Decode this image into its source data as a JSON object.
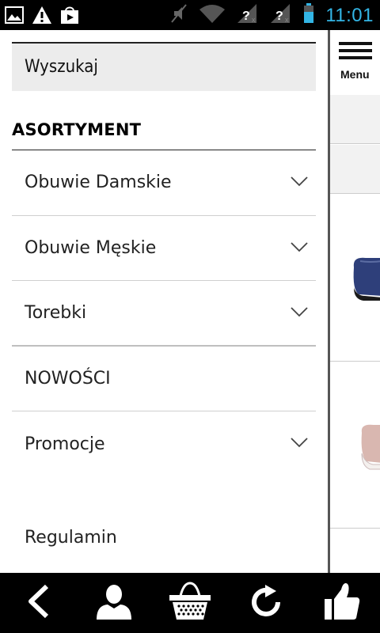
{
  "status_bar": {
    "time": "11:01",
    "icons": [
      "image-icon",
      "warning-icon",
      "store-icon",
      "mute-icon",
      "wifi-icon",
      "no-signal-icon",
      "no-signal-icon",
      "battery-icon"
    ]
  },
  "drawer": {
    "search_placeholder": "Wyszukaj",
    "section_title": "ASORTYMENT",
    "items": [
      {
        "label": "Obuwie Damskie",
        "expandable": true
      },
      {
        "label": "Obuwie Męskie",
        "expandable": true
      },
      {
        "label": "Torebki",
        "expandable": true
      },
      {
        "label": "NOWOŚCI",
        "expandable": false
      },
      {
        "label": "Promocje",
        "expandable": true
      }
    ],
    "footer_link": "Regulamin"
  },
  "content": {
    "menu_label": "Menu"
  },
  "bottom_nav": {
    "buttons": [
      "back-icon",
      "user-icon",
      "basket-icon",
      "refresh-icon",
      "thumbs-up-icon"
    ]
  },
  "colors": {
    "status_time": "#33b5e5",
    "search_bg": "#ececec",
    "shoe_blue": "#2e3f7a",
    "shoe_pink": "#d9b7b0"
  }
}
